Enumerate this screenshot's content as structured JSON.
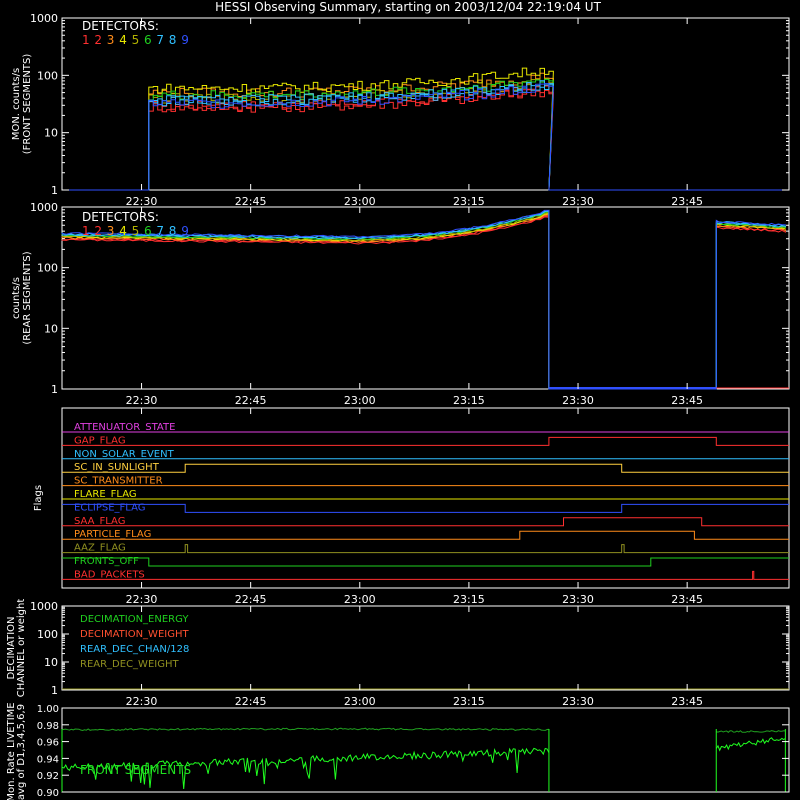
{
  "title": "HESSI Observing Summary, starting on 2003/12/04 22:19:04 UT",
  "colors": {
    "background": "#000000",
    "axes": "#ffffff",
    "detectors": [
      "#ff3030",
      "#ff3030",
      "#ff8c1a",
      "#e8e800",
      "#b0b000",
      "#20d020",
      "#30c0ff",
      "#30c0ff",
      "#3050ff"
    ]
  },
  "chart_data": [
    {
      "id": "front",
      "type": "line",
      "ylabel_line1": "MON. counts/s",
      "ylabel_line2": "(FRONT SEGMENTS)",
      "ylog": true,
      "ylim": [
        1,
        1000
      ],
      "ytick_labels": [
        "1",
        "10",
        "100",
        "1000"
      ],
      "xtick_labels": [
        "22:30",
        "22:45",
        "23:00",
        "23:15",
        "23:30",
        "23:45"
      ],
      "legend_title": "DETECTORS:",
      "legend_numbers": [
        "1",
        "2",
        "3",
        "4",
        "5",
        "6",
        "7",
        "8",
        "9"
      ],
      "data_start": "22:31:00",
      "data_end": "23:26:00",
      "series": [
        {
          "label": "1",
          "start_value": 30,
          "end_value": 60
        },
        {
          "label": "2",
          "start_value": 28,
          "end_value": 55
        },
        {
          "label": "3",
          "start_value": 50,
          "end_value": 100
        },
        {
          "label": "4",
          "start_value": 60,
          "end_value": 130
        },
        {
          "label": "5",
          "start_value": 40,
          "end_value": 80
        },
        {
          "label": "6",
          "start_value": 45,
          "end_value": 85
        },
        {
          "label": "7",
          "start_value": 38,
          "end_value": 75
        },
        {
          "label": "8",
          "start_value": 36,
          "end_value": 70
        },
        {
          "label": "9",
          "start_value": 33,
          "end_value": 65
        }
      ]
    },
    {
      "id": "rear",
      "type": "line",
      "ylabel_line1": "counts/s",
      "ylabel_line2": "(REAR SEGMENTS)",
      "ylog": true,
      "ylim": [
        1,
        1000
      ],
      "ytick_labels": [
        "1",
        "10",
        "100",
        "1000"
      ],
      "xtick_labels": [
        "22:30",
        "22:45",
        "23:00",
        "23:15",
        "23:30",
        "23:45"
      ],
      "legend_title": "DETECTORS:",
      "legend_numbers": [
        "1",
        "2",
        "3",
        "4",
        "5",
        "6",
        "7",
        "8",
        "9"
      ],
      "segments": [
        {
          "start": "22:19:04",
          "end": "23:26:00",
          "start_value": 330,
          "mid_value": 290,
          "end_value": 800
        },
        {
          "start": "23:49:00",
          "end": "23:58:30",
          "start_value": 520,
          "end_value": 450
        }
      ]
    },
    {
      "id": "flags",
      "type": "line",
      "ylabel": "Flags",
      "xtick_labels": [
        "22:30",
        "22:45",
        "23:00",
        "23:15",
        "23:30",
        "23:45"
      ],
      "flags": [
        {
          "name": "ATTENUATOR_STATE",
          "color": "#e040e0",
          "steps": []
        },
        {
          "name": "GAP_FLAG",
          "color": "#ff3030",
          "steps": [
            [
              "23:26:00",
              1
            ],
            [
              "23:49:00",
              0
            ]
          ]
        },
        {
          "name": "NON_SOLAR_EVENT",
          "color": "#30c0ff",
          "steps": []
        },
        {
          "name": "SC_IN_SUNLIGHT",
          "color": "#ffd040",
          "steps": [
            [
              "22:36:00",
              1
            ],
            [
              "23:36:00",
              0
            ]
          ]
        },
        {
          "name": "SC_TRANSMITTER",
          "color": "#ff8c1a",
          "steps": []
        },
        {
          "name": "FLARE_FLAG",
          "color": "#e8e800",
          "steps": []
        },
        {
          "name": "ECLIPSE_FLAG",
          "color": "#3050ff",
          "steps": [
            [
              "22:19:04",
              1
            ],
            [
              "22:36:00",
              0
            ],
            [
              "23:36:00",
              1
            ]
          ]
        },
        {
          "name": "SAA_FLAG",
          "color": "#ff3030",
          "steps": [
            [
              "23:28:00",
              1
            ],
            [
              "23:47:00",
              0
            ]
          ]
        },
        {
          "name": "PARTICLE_FLAG",
          "color": "#ff8c1a",
          "steps": [
            [
              "23:22:00",
              1
            ],
            [
              "23:46:00",
              0
            ]
          ]
        },
        {
          "name": "AAZ_FLAG",
          "color": "#909020",
          "steps": [
            [
              "22:36:00",
              1
            ],
            [
              "22:36:20",
              0
            ],
            [
              "23:36:00",
              1
            ],
            [
              "23:36:20",
              0
            ]
          ]
        },
        {
          "name": "FRONTS_OFF",
          "color": "#20d020",
          "steps": [
            [
              "22:19:04",
              1
            ],
            [
              "22:31:00",
              0
            ],
            [
              "23:40:00",
              1
            ]
          ]
        },
        {
          "name": "BAD_PACKETS",
          "color": "#ff3030",
          "steps": [
            [
              "23:54:00",
              1
            ],
            [
              "23:54:10",
              0
            ]
          ]
        }
      ]
    },
    {
      "id": "decimation",
      "type": "line",
      "ylabel_line1": "DECIMATION",
      "ylabel_line2": "CHANNEL or weight",
      "ylog": true,
      "ylim": [
        1,
        1000
      ],
      "ytick_labels": [
        "1",
        "10",
        "100",
        "1000"
      ],
      "xtick_labels": [
        "22:30",
        "22:45",
        "23:00",
        "23:15",
        "23:30",
        "23:45"
      ],
      "legend": [
        {
          "name": "DECIMATION_ENERGY",
          "color": "#20d020"
        },
        {
          "name": "DECIMATION_WEIGHT",
          "color": "#ff5030"
        },
        {
          "name": "REAR_DEC_CHAN/128",
          "color": "#30c0ff"
        },
        {
          "name": "REAR_DEC_WEIGHT",
          "color": "#909020"
        }
      ],
      "constant_value": 1
    },
    {
      "id": "livetime",
      "type": "line",
      "ylabel_line1": "Mon. Rate LIVETIME",
      "ylabel_line2": "avg of D1,3,4,5,6,9",
      "ylim": [
        0.9,
        1.0
      ],
      "ytick_labels": [
        "0.90",
        "0.92",
        "0.94",
        "0.96",
        "0.98",
        "1.00"
      ],
      "annotation": "FRONT SEGMENTS",
      "upper_trace_value": 0.975,
      "segments": [
        {
          "start": "22:19:04",
          "end": "23:26:00"
        },
        {
          "start": "23:49:00",
          "end": "23:58:30"
        }
      ]
    }
  ]
}
